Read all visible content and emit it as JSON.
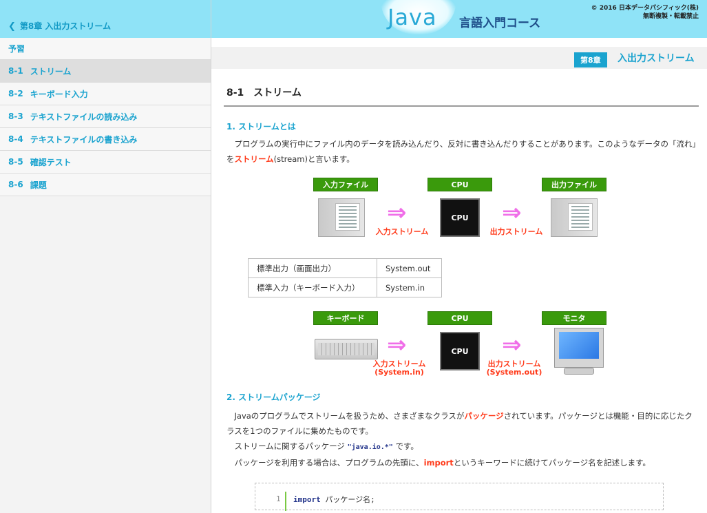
{
  "sidebar": {
    "back_label": "第8章 入出力ストリーム",
    "items": [
      {
        "num": "",
        "label": "予習"
      },
      {
        "num": "8-1",
        "label": "ストリーム"
      },
      {
        "num": "8-2",
        "label": "キーボード入力"
      },
      {
        "num": "8-3",
        "label": "テキストファイルの読み込み"
      },
      {
        "num": "8-4",
        "label": "テキストファイルの書き込み"
      },
      {
        "num": "8-5",
        "label": "確認テスト"
      },
      {
        "num": "8-6",
        "label": "課題"
      }
    ],
    "active_index": 1
  },
  "header": {
    "logo_main": "Java",
    "logo_sub": "言語入門コース",
    "copyright_line1": "© 2016 日本データパシフィック(株)",
    "copyright_line2": "無断複製・転載禁止"
  },
  "chapter": {
    "badge": "第8章",
    "title": "入出力ストリーム"
  },
  "content": {
    "section_title": "8-1　ストリーム",
    "h1": "1. ストリームとは",
    "p1_a": "プログラムの実行中にファイル内のデータを読み込んだり、反対に書き込んだりすることがあります。このようなデータの「流れ」を",
    "p1_red": "ストリーム",
    "p1_b": "(stream)と言います。",
    "diagram1": {
      "label_left": "入力ファイル",
      "label_mid": "CPU",
      "label_right": "出力ファイル",
      "cpu_text": "CPU",
      "stream_in": "入力ストリーム",
      "stream_out": "出力ストリーム"
    },
    "table": [
      [
        "標準出力（画面出力）",
        "System.out"
      ],
      [
        "標準入力（キーボード入力）",
        "System.in"
      ]
    ],
    "diagram2": {
      "label_left": "キーボード",
      "label_mid": "CPU",
      "label_right": "モニタ",
      "cpu_text": "CPU",
      "stream_in": "入力ストリーム",
      "stream_in_sub": "(System.in)",
      "stream_out": "出力ストリーム",
      "stream_out_sub": "(System.out)"
    },
    "h2": "2. ストリームパッケージ",
    "p2_a": "Javaのプログラムでストリームを扱うため、さまざまなクラスが",
    "p2_red": "パッケージ",
    "p2_b": "されています。パッケージとは機能・目的に応じたクラスを1つのファイルに集めたものです。",
    "p3_a": "ストリームに関するパッケージ",
    "p3_code": "\"java.io.*\"",
    "p3_b": "です。",
    "p4_a": "パッケージを利用する場合は、プログラムの先頭に、",
    "p4_red": "import",
    "p4_b": "というキーワードに続けてパッケージ名を記述します。",
    "code": {
      "line_no": "1",
      "keyword": "import",
      "rest": " パッケージ名;"
    }
  }
}
